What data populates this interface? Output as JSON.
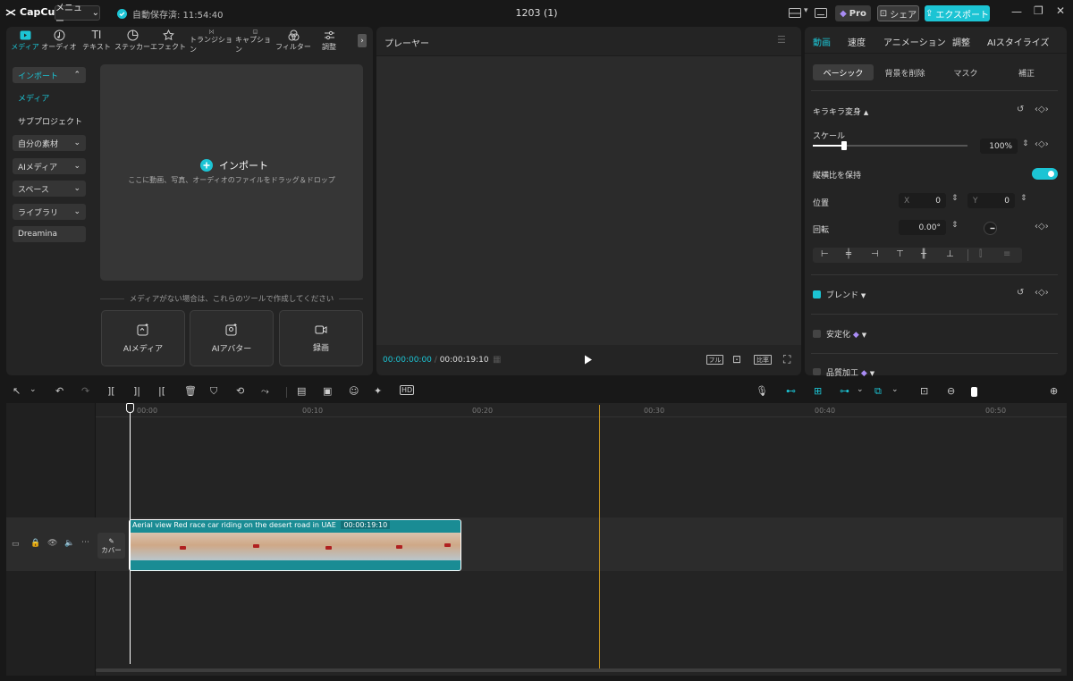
{
  "app": {
    "logo_text": "CapCut",
    "menu_label": "メニュー",
    "autosave_text": "自動保存済: 11:54:40",
    "project_title": "1203 (1)",
    "pro_label": "Pro",
    "share_label": "シェア",
    "export_label": "エクスポート"
  },
  "left": {
    "tabs": [
      "メディア",
      "オーディオ",
      "テキスト",
      "ステッカー",
      "エフェクト",
      "トランジション",
      "キャプション",
      "フィルター",
      "調整"
    ],
    "nav": {
      "import": "インポート",
      "media": "メディア",
      "subproject": "サブプロジェクト",
      "my_assets": "自分の素材",
      "ai_media": "AIメディア",
      "space": "スペース",
      "library": "ライブラリ",
      "dreamina": "Dreamina"
    },
    "import_label": "インポート",
    "import_hint": "ここに動画、写真、オーディオのファイルをドラッグ＆ドロップ",
    "no_media_text": "メディアがない場合は、これらのツールで作成してください",
    "tools": [
      "AIメディア",
      "AIアバター",
      "録画"
    ]
  },
  "player": {
    "title": "プレーヤー",
    "current_time": "00:00:00:00",
    "total_time": "00:00:19:10",
    "full_label": "フル",
    "ratio_label": "比率"
  },
  "right": {
    "tabs": [
      "動画",
      "速度",
      "アニメーション",
      "調整",
      "AIスタイライズ"
    ],
    "subtabs": [
      "ベーシック",
      "背景を削除",
      "マスク",
      "補正"
    ],
    "sparkle_label": "キラキラ変身",
    "scale_label": "スケール",
    "scale_value": "100%",
    "scale_fraction": 0.2,
    "keep_ratio_label": "縦横比を保持",
    "keep_ratio_on": true,
    "position_label": "位置",
    "x_label": "X",
    "x_value": "0",
    "y_label": "Y",
    "y_value": "0",
    "rotation_label": "回転",
    "rotation_value": "0.00°",
    "blend_label": "ブレンド",
    "stabilize_label": "安定化",
    "quality_label": "品質加工"
  },
  "timeline": {
    "ruler": [
      "00:00",
      "00:10",
      "00:20",
      "00:30",
      "00:40",
      "00:50"
    ],
    "clip_title": "Aerial view Red race car riding on the desert road in UAE",
    "clip_duration": "00:00:19:10",
    "cover_label": "カバー"
  },
  "colors": {
    "accent": "#1cc4d4",
    "clip_border": "#1a8c94",
    "playhead_marker": "#c8961e"
  }
}
